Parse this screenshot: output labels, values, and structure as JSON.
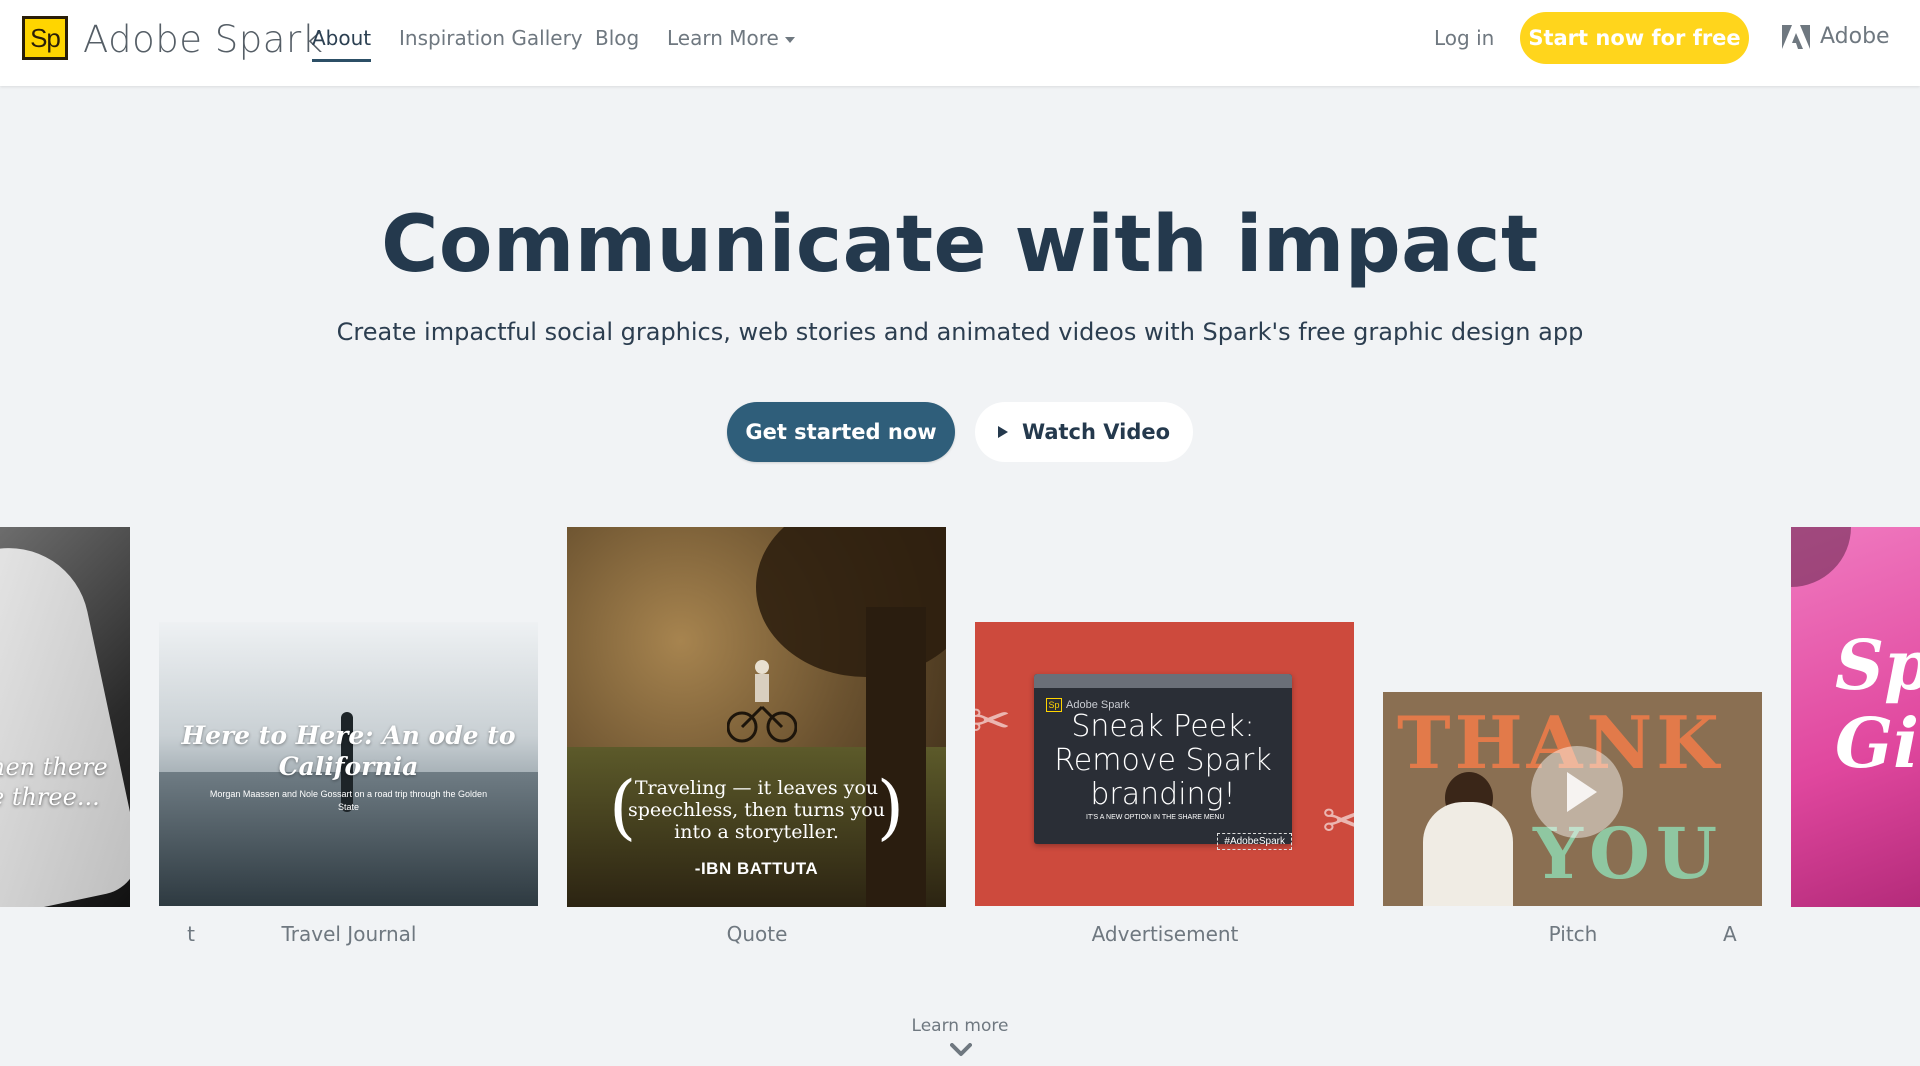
{
  "header": {
    "logo_badge": "Sp",
    "brand": "Adobe Spark",
    "nav": [
      "About",
      "Inspiration Gallery",
      "Blog",
      "Learn More"
    ],
    "login": "Log in",
    "cta": "Start now for free",
    "adobe": "Adobe"
  },
  "hero": {
    "title": "Communicate with impact",
    "subtitle": "Create impactful social graphics, web stories and animated videos with Spark's free graphic design app",
    "primary_button": "Get started now",
    "secondary_button": "Watch Video"
  },
  "cards": {
    "hand": {
      "overlay_line1": "hen there",
      "overlay_line2": "e three...",
      "label": "t"
    },
    "travel": {
      "title": "Here to Here: An ode to California",
      "subtitle": "Morgan Maassen and Nole Gossart on a road trip through the Golden State",
      "label": "Travel Journal"
    },
    "quote": {
      "text": "Traveling — it leaves you speechless, then turns you into a storyteller.",
      "author": "-IBN BATTUTA",
      "label": "Quote"
    },
    "ad": {
      "brand": "Adobe Spark",
      "headline": "Sneak Peek: Remove Spark branding!",
      "note": "IT'S A NEW OPTION IN THE SHARE MENU",
      "tag": "#AdobeSpark",
      "label": "Advertisement"
    },
    "pitch": {
      "top_text": "THANK",
      "bottom_text": "YOU",
      "label": "Pitch"
    },
    "gift": {
      "text_line1": "Sp",
      "text_line2": "Gi",
      "label": "A"
    }
  },
  "footer": {
    "learn_more": "Learn more"
  },
  "colors": {
    "accent_yellow": "#ffd51c",
    "primary_blue": "#2f5e7a",
    "title_navy": "#24394d",
    "page_bg": "#f1f3f5"
  }
}
